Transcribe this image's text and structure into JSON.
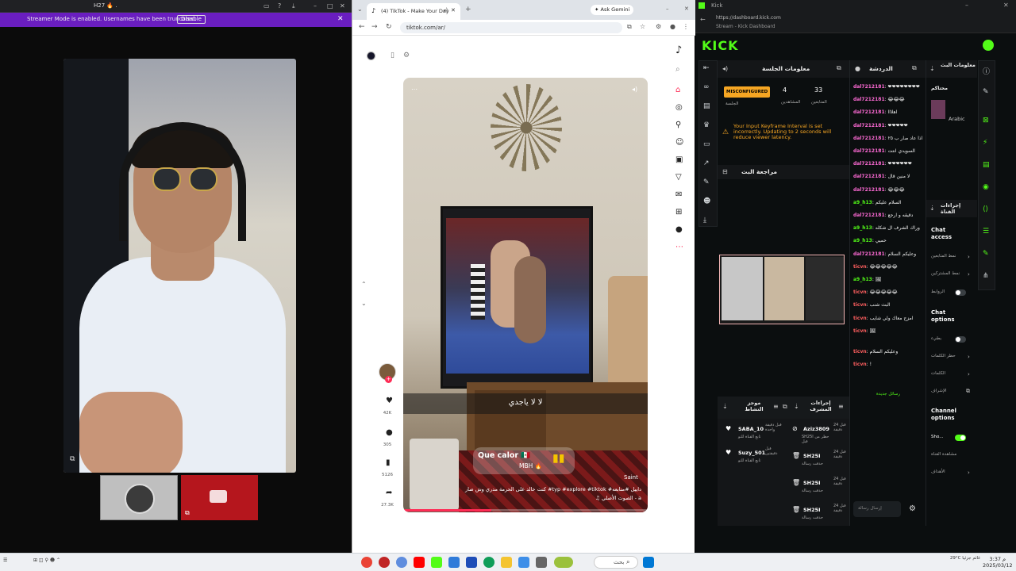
{
  "left": {
    "window_title": "H27 🔥 .",
    "banner_text": "Streamer Mode is enabled. Usernames have been truncated.",
    "banner_button": "Disable"
  },
  "browser": {
    "tab_title": "(4) TikTok - Make Your Day",
    "gemini": "✦ Ask Gemini",
    "url": "tiktok.com/ar/",
    "video": {
      "subtitle": "لا لا ياجدي",
      "sticker_text": "Que calor 🇲🇽",
      "sticker_sub": "MBH 🔥",
      "watermark": "Saint",
      "caption_line1": "كنت خالد على الحرمة مدري وش صار #typ #explore #tiktok #داييل #متابعه",
      "caption_line2": "♫ الصوت الأصلي - a",
      "progress": 0.36
    },
    "actions": [
      {
        "icon": "heart-icon",
        "glyph": "♥",
        "count": "42K"
      },
      {
        "icon": "comment-icon",
        "glyph": "●",
        "count": "305"
      },
      {
        "icon": "bookmark-icon",
        "glyph": "▮",
        "count": "5126"
      },
      {
        "icon": "share-icon",
        "glyph": "➦",
        "count": "27.3K"
      }
    ]
  },
  "kick": {
    "tab_title": "Kick",
    "url": "https://dashboard.kick.com",
    "url_sub": "Stream - Kick Dashboard",
    "logo": "KICK",
    "session_info_title": "معلومات الجلسة",
    "misconfigured": "MISCONFIGURED",
    "session_label": "الجلسة",
    "viewers": {
      "value": "4",
      "label": "المشاهدين"
    },
    "followers": {
      "value": "33",
      "label": "المتابعين"
    },
    "warning": "Your Input Keyframe Interval is set incorrectly. Updating to 2 seconds will reduce viewer latency.",
    "stream_review": "مراجعة البث",
    "chat_title": "الدردشة",
    "stream_info_title": "معلومات البث",
    "stream_info_user": "محتاكم",
    "stream_info_cat": "Arabic",
    "stream_actions_title": "إجراءات القناة",
    "chat_access": "Chat access",
    "chat_options": "Chat options",
    "channel_options": "Channel options",
    "channel_toggle_label": "Sho...",
    "opt_rows": [
      "نمط المتابعين",
      "نمط المشتركين",
      "الروابط",
      "بطيء",
      "حظر الكلمات",
      "الكلمات",
      "الإشراف",
      "مشاهدة القناة",
      "الأهداف"
    ],
    "chat_messages": [
      {
        "user": "dal7212181",
        "cls": "u",
        "text": ": ❤❤❤❤❤❤❤❤"
      },
      {
        "user": "dal7212181",
        "cls": "u",
        "text": ": 😂😂😂"
      },
      {
        "user": "dal7212181",
        "cls": "u",
        "text": ": اهلااا"
      },
      {
        "user": "dal7212181",
        "cls": "u",
        "text": ": ❤❤❤❤❤"
      },
      {
        "user": "dal7212181",
        "cls": "u",
        "text": ": اذا عاد صار ب ٢٥"
      },
      {
        "user": "dal7212181",
        "cls": "u",
        "text": ": السويدي انتت"
      },
      {
        "user": "dal7212181",
        "cls": "u",
        "text": ": ❤❤❤❤❤❤"
      },
      {
        "user": "dal7212181",
        "cls": "u",
        "text": ": لا منين قال"
      },
      {
        "user": "dal7212181",
        "cls": "u",
        "text": ": 😂😂😂"
      },
      {
        "user": "a9_h13",
        "cls": "u2",
        "text": ": السلام عليكم"
      },
      {
        "user": "dal7212181",
        "cls": "u",
        "text": ": دقيقه و ارجع"
      },
      {
        "user": "a9_h13",
        "cls": "u2",
        "text": ": وراك الشرف ال شكله"
      },
      {
        "user": "a9_h13",
        "cls": "u2",
        "text": ": حميي"
      },
      {
        "user": "dal7212181",
        "cls": "u",
        "text": ": وعليكم السلام"
      },
      {
        "user": "ticvn",
        "cls": "u3",
        "text": ": 😂😂😂😂😂"
      },
      {
        "user": "a9_h13",
        "cls": "u2",
        "text": ": 🖼"
      },
      {
        "user": "ticvn",
        "cls": "u3",
        "text": ": 😂😂😂😂😂"
      },
      {
        "user": "ticvn",
        "cls": "u3",
        "text": ": البث شنب"
      },
      {
        "user": "ticvn",
        "cls": "u3",
        "text": ": امزح معاك ولي شايب"
      },
      {
        "user": "ticvn",
        "cls": "u3",
        "text": ": 🖼"
      },
      {
        "user": "ticvn",
        "cls": "u3",
        "text": ": وعليكم السلام"
      },
      {
        "user": "ticvn",
        "cls": "u3",
        "text": ": !"
      }
    ],
    "new_messages": "رسائل جديدة",
    "chat_placeholder": "إرسال رسالة",
    "mods_title_1": "موجز النشاط",
    "mods_title_2": "إجراءات المشرف",
    "activity": [
      {
        "name": "SABA_10",
        "sub": "تابع القناة للتو",
        "time": "قبل دقيقة واحدة"
      },
      {
        "name": "Suzy_501",
        "sub": "تابع القناة للتو",
        "time": "قبل دقيقتين"
      }
    ],
    "modactions": [
      {
        "name": "Aziz3809",
        "sub": "SH25I حظر من قبل",
        "time": "قبل 24 دقيقة"
      },
      {
        "name": "SH25I",
        "sub": "حذفت رسالة",
        "time": "قبل 24 دقيقة"
      },
      {
        "name": "SH25I",
        "sub": "حذفت رسالة",
        "time": "قبل 24 دقيقة"
      },
      {
        "name": "SH25I",
        "sub": "حذفت رسالة",
        "time": "قبل 24 دقيقة"
      }
    ]
  },
  "taskbar": {
    "weather": "29°C غائم جزئيا",
    "search": "بحث",
    "clock_time": "3:37 م",
    "clock_date": "2025/03/12"
  }
}
